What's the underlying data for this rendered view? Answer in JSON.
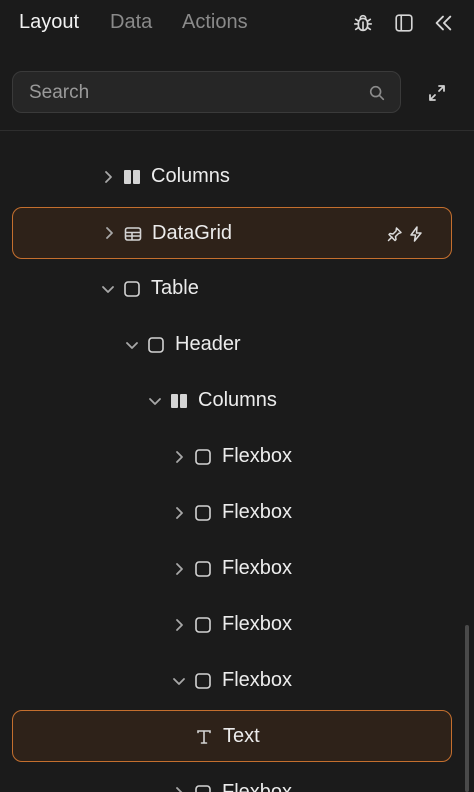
{
  "tabs": [
    {
      "label": "Layout",
      "active": true
    },
    {
      "label": "Data",
      "active": false
    },
    {
      "label": "Actions",
      "active": false
    }
  ],
  "top_icons": [
    "bug-icon",
    "panel-icon",
    "collapse-icon"
  ],
  "search": {
    "placeholder": "Search",
    "value": ""
  },
  "tree_items": [
    {
      "label": "Columns",
      "icon": "columns-icon",
      "expanded": false,
      "depth": 0
    },
    {
      "label": "DataGrid",
      "icon": "datagrid-icon",
      "expanded": false,
      "depth": 0,
      "selected": true,
      "extra_icons": [
        "pin-icon",
        "bolt-icon"
      ]
    },
    {
      "label": "Table",
      "icon": "box-icon",
      "expanded": true,
      "depth": 0
    },
    {
      "label": "Header",
      "icon": "box-icon",
      "expanded": true,
      "depth": 1
    },
    {
      "label": "Columns",
      "icon": "columns-icon",
      "expanded": true,
      "depth": 2
    },
    {
      "label": "Flexbox",
      "icon": "box-icon",
      "expanded": false,
      "depth": 3
    },
    {
      "label": "Flexbox",
      "icon": "box-icon",
      "expanded": false,
      "depth": 3
    },
    {
      "label": "Flexbox",
      "icon": "box-icon",
      "expanded": false,
      "depth": 3
    },
    {
      "label": "Flexbox",
      "icon": "box-icon",
      "expanded": false,
      "depth": 3
    },
    {
      "label": "Flexbox",
      "icon": "box-icon",
      "expanded": true,
      "depth": 3
    },
    {
      "label": "Text",
      "icon": "text-icon",
      "depth": 4,
      "selected": true
    },
    {
      "label": "Flexbox",
      "icon": "box-icon",
      "expanded": false,
      "depth": 3
    }
  ],
  "colors": {
    "accent_border": "#c46f2e",
    "selected_bg": "#2e2219",
    "background": "#1b1b1b"
  }
}
